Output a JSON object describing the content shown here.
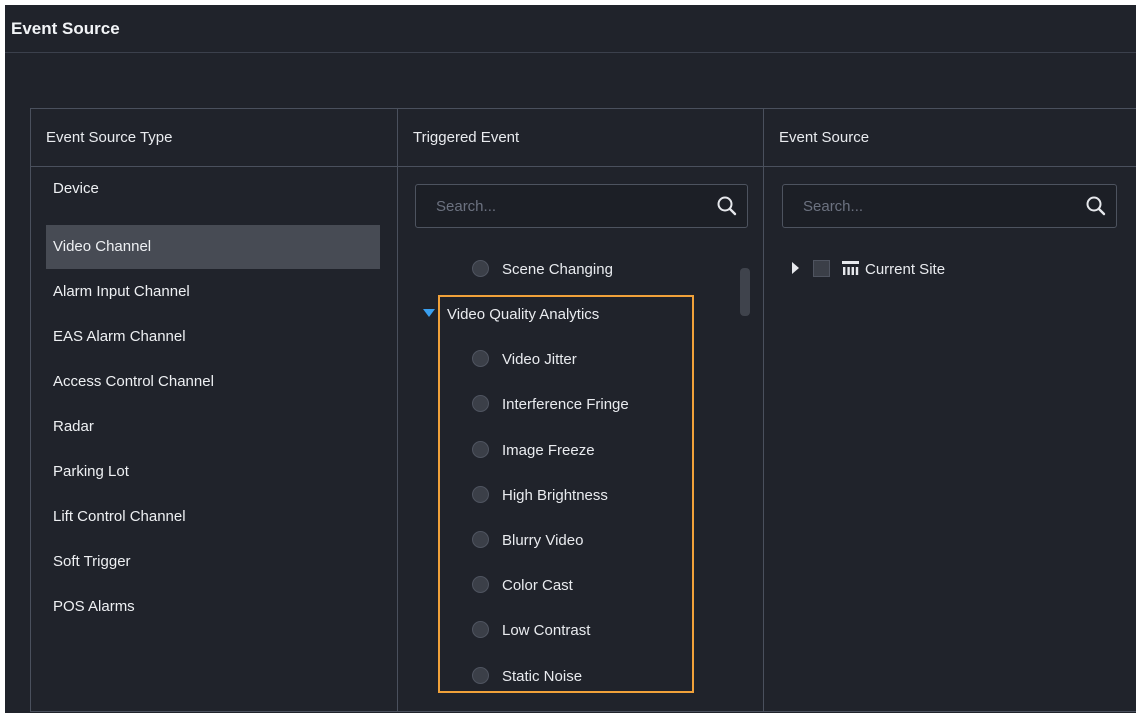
{
  "panel": {
    "title": "Event Source"
  },
  "columns": {
    "source_type": {
      "header": "Event Source Type"
    },
    "triggered_event": {
      "header": "Triggered Event"
    },
    "event_source": {
      "header": "Event Source"
    }
  },
  "source_types": [
    {
      "label": "Device",
      "selected": false
    },
    {
      "label": "Video Channel",
      "selected": true
    },
    {
      "label": "Alarm Input Channel",
      "selected": false
    },
    {
      "label": "EAS Alarm Channel",
      "selected": false
    },
    {
      "label": "Access Control Channel",
      "selected": false
    },
    {
      "label": "Radar",
      "selected": false
    },
    {
      "label": "Parking Lot",
      "selected": false
    },
    {
      "label": "Lift Control Channel",
      "selected": false
    },
    {
      "label": "Soft Trigger",
      "selected": false
    },
    {
      "label": "POS Alarms",
      "selected": false
    }
  ],
  "triggered_search": {
    "placeholder": "Search..."
  },
  "events": {
    "above_item": "Scene Changing",
    "group_label": "Video Quality Analytics",
    "group_items": [
      "Video Jitter",
      "Interference Fringe",
      "Image Freeze",
      "High Brightness",
      "Blurry Video",
      "Color Cast",
      "Low Contrast",
      "Static Noise"
    ]
  },
  "source_search": {
    "placeholder": "Search..."
  },
  "tree": {
    "root_label": "Current Site"
  },
  "colors": {
    "background": "#20232b",
    "selected_row": "#474b54",
    "highlight_border": "#f0a13a",
    "expand_arrow": "#3aa0f0"
  }
}
